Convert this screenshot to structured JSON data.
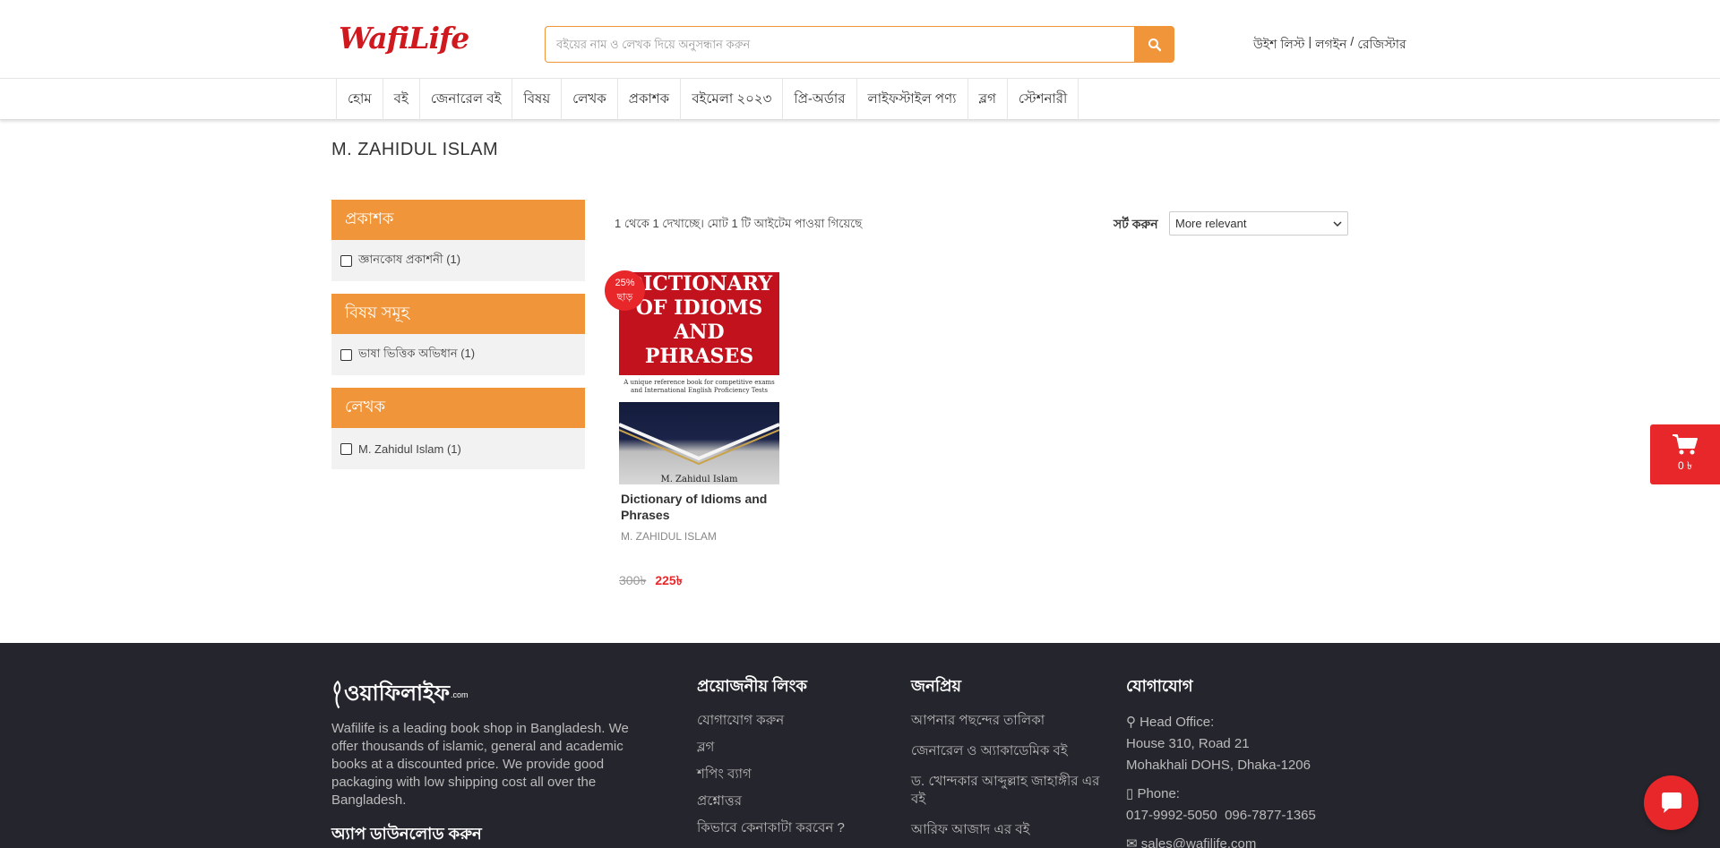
{
  "header": {
    "brand": "WafiLife",
    "search_placeholder": "বইয়ের নাম ও লেখক দিয়ে অনুসন্ধান করুন",
    "wishlist": "উইশ লিস্ট",
    "login": "লগইন",
    "register": "রেজিস্টার",
    "separator1": "|",
    "separator2": "/"
  },
  "nav": {
    "items": [
      "হোম",
      "বই",
      "জেনারেল বই",
      "বিষয়",
      "লেখক",
      "প্রকাশক",
      "বইমেলা ২০২৩",
      "প্রি-অর্ডার",
      "লাইফস্টাইল পণ্য",
      "ব্লগ",
      "স্টেশনারী"
    ]
  },
  "page": {
    "title": "M. ZAHIDUL ISLAM"
  },
  "filters": [
    {
      "heading": "প্রকাশক",
      "option": "জ্ঞানকোষ প্রকাশনী (1)"
    },
    {
      "heading": "বিষয় সমূহ",
      "option": "ভাষা ভিত্তিক অভিধান (1)"
    },
    {
      "heading": "লেখক",
      "option": "M. Zahidul Islam (1)"
    }
  ],
  "results": {
    "count_text": "1 থেকে 1 দেখাচ্ছে। মোট 1 টি আইটেম পাওয়া গিয়েছে",
    "sort_label": "সর্ট করুন",
    "sort_value": "More relevant"
  },
  "product": {
    "badge_percent": "25%",
    "badge_text": "ছাড়",
    "cover_title": "DICTIONARY OF IDIOMS AND PHRASES",
    "cover_subtitle": "A unique reference book for competitive exams and International English Proficiency Tests",
    "cover_author": "M. Zahidul Islam",
    "title": "Dictionary of Idioms and Phrases",
    "author": "M. ZAHIDUL ISLAM",
    "old_price": "300৳",
    "new_price": "225৳"
  },
  "cart": {
    "amount": "0 ৳"
  },
  "footer": {
    "logo_text": "ওয়াফিলাইফ",
    "logo_suffix": ".com",
    "description": "Wafilife is a leading book shop in Bangladesh. We offer thousands of islamic, general and academic books at a discounted price. We provide good packaging with low shipping cost all over the Bangladesh.",
    "app_download": "অ্যাপ ডাউনলোড করুন",
    "links_heading": "প্রয়োজনীয় লিংক",
    "links": [
      "যোগাযোগ করুন",
      "ব্লগ",
      "শপিং ব্যাগ",
      "প্রশ্নোত্তর",
      "কিভাবে কেনাকাটা করবেন ?"
    ],
    "popular_heading": "জনপ্রিয়",
    "popular": [
      "আপনার পছন্দের তালিকা",
      "জেনারেল ও অ্যাকাডেমিক বই",
      "ড. খোন্দকার আব্দুল্লাহ জাহাঙ্গীর এর বই",
      "আরিফ আজাদ এর বই"
    ],
    "contact_heading": "যোগাযোগ",
    "head_office_label": "Head Office:",
    "address1": "House 310, Road 21",
    "address2": "Mohakhali DOHS, Dhaka-1206",
    "phone_label": "Phone:",
    "phones": "017-9992-5050  096-7877-1365",
    "email": "sales@wafilife.com"
  },
  "colors": {
    "accent": "#f0953a",
    "brand_red": "#d0191f",
    "sale_red": "#e8272b",
    "footer_bg": "#25262d"
  }
}
